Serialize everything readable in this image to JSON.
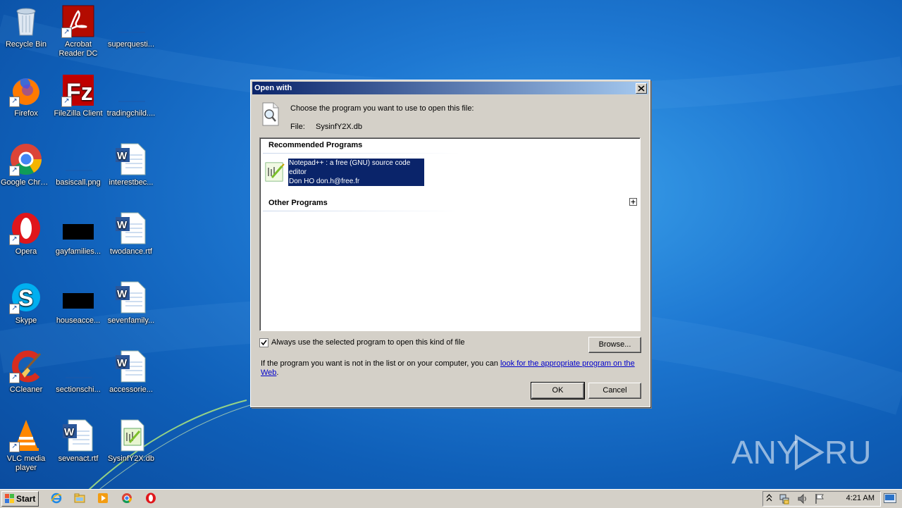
{
  "desktop": {
    "icons": [
      {
        "label": "Recycle Bin",
        "icon": "recycle-bin-icon"
      },
      {
        "label": "Acrobat Reader DC",
        "icon": "acrobat-icon"
      },
      {
        "label": "superquesti...",
        "icon": "blank-file-icon"
      },
      {
        "label": "Firefox",
        "icon": "firefox-icon"
      },
      {
        "label": "FileZilla Client",
        "icon": "filezilla-icon"
      },
      {
        "label": "tradingchild....",
        "icon": "blank-file-icon"
      },
      {
        "label": "Google Chrome",
        "icon": "chrome-icon"
      },
      {
        "label": "basiscall.png",
        "icon": "image-file-icon"
      },
      {
        "label": "interestbec...",
        "icon": "word-doc-icon"
      },
      {
        "label": "Opera",
        "icon": "opera-icon"
      },
      {
        "label": "gayfamilies...",
        "icon": "black-file-icon"
      },
      {
        "label": "twodance.rtf",
        "icon": "word-doc-icon"
      },
      {
        "label": "Skype",
        "icon": "skype-icon"
      },
      {
        "label": "houseacce...",
        "icon": "black-file-icon"
      },
      {
        "label": "sevenfamily...",
        "icon": "word-doc-icon"
      },
      {
        "label": "CCleaner",
        "icon": "ccleaner-icon"
      },
      {
        "label": "sectionschi...",
        "icon": "blank-file-icon"
      },
      {
        "label": "accessorie...",
        "icon": "word-doc-icon"
      },
      {
        "label": "VLC media player",
        "icon": "vlc-icon"
      },
      {
        "label": "sevenact.rtf",
        "icon": "word-doc-icon"
      },
      {
        "label": "SysinfY2X.db",
        "icon": "notepadpp-file-icon"
      }
    ]
  },
  "dialog": {
    "title": "Open with",
    "close_label": "x",
    "instruction": "Choose the program you want to use to open this file:",
    "file_label": "File:",
    "file_name": "SysinfY2X.db",
    "recommended_header": "Recommended Programs",
    "recommended_item": {
      "line1": "Notepad++ : a free (GNU) source code",
      "line2": "editor",
      "line3": "Don HO don.h@free.fr"
    },
    "other_header": "Other Programs",
    "expand_label": "+",
    "always_use_label": "Always use the selected program to open this kind of file",
    "always_use_checked": true,
    "browse_label": "Browse...",
    "info_prefix": "If the program you want is not in the list or on your computer, you can ",
    "info_link_line1": "look for the appropriate program on the",
    "info_link_line2": "Web",
    "info_suffix": ".",
    "ok_label": "OK",
    "cancel_label": "Cancel"
  },
  "watermark": {
    "text": "ANY RUN"
  },
  "taskbar": {
    "start_label": "Start",
    "quick_launch": [
      "ie-icon",
      "explorer-icon",
      "media-player-icon",
      "chrome-icon",
      "opera-icon"
    ],
    "clock": "4:21 AM",
    "tray_icons": [
      "show-hidden-icons-icon",
      "network-icon",
      "volume-icon",
      "action-center-flag-icon"
    ]
  }
}
